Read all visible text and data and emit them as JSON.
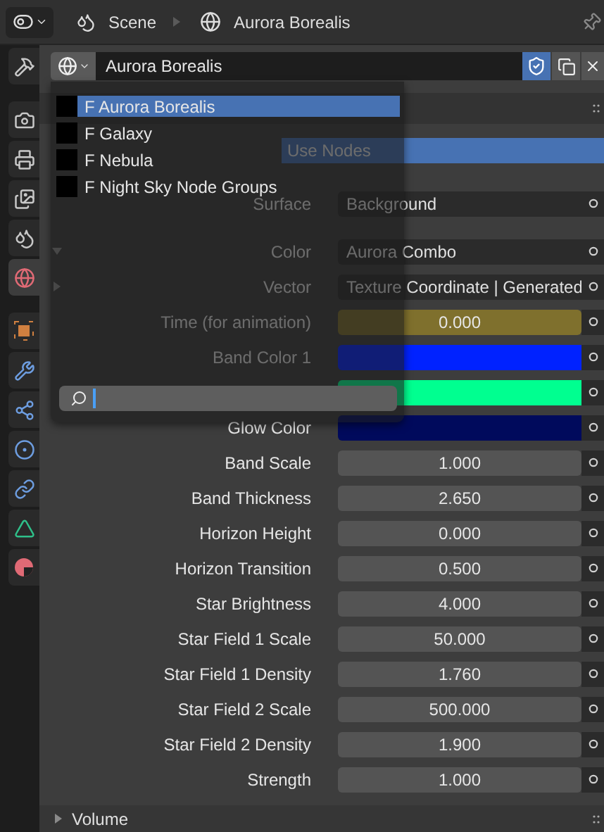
{
  "header": {
    "scene": "Scene",
    "world": "Aurora Borealis"
  },
  "sidebar": {
    "groups": [
      {
        "tabs": [
          {
            "kind": "tool",
            "selected": false
          }
        ]
      },
      {
        "tabs": [
          {
            "kind": "render",
            "selected": false
          },
          {
            "kind": "output",
            "selected": false
          },
          {
            "kind": "view_layer",
            "selected": false
          },
          {
            "kind": "scene",
            "selected": false
          },
          {
            "kind": "world",
            "selected": true
          }
        ]
      },
      {
        "tabs": [
          {
            "kind": "object",
            "selected": false
          },
          {
            "kind": "modifier",
            "selected": false
          },
          {
            "kind": "particles",
            "selected": false
          },
          {
            "kind": "physics",
            "selected": false
          },
          {
            "kind": "constraints",
            "selected": false
          },
          {
            "kind": "data",
            "selected": false
          },
          {
            "kind": "material",
            "selected": false
          }
        ]
      }
    ]
  },
  "datablock": {
    "name": "Aurora Borealis",
    "fake_user": true
  },
  "dropdown": {
    "items": [
      {
        "label": "F Aurora Borealis",
        "selected": true
      },
      {
        "label": "F Galaxy",
        "selected": false
      },
      {
        "label": "F Nebula",
        "selected": false
      },
      {
        "label": "F Night Sky Node Groups",
        "selected": false
      }
    ]
  },
  "use_nodes": {
    "label": "Use Nodes",
    "on": true
  },
  "inputs": [
    {
      "kind": "link",
      "label": "Surface",
      "value": "Background"
    },
    {
      "kind": "link",
      "label": "Color",
      "value": "Aurora Combo",
      "expanded": true
    },
    {
      "kind": "link",
      "label": "Vector",
      "value": "Texture Coordinate | Generated",
      "expanded": false
    },
    {
      "kind": "number",
      "label": "Time (for animation)",
      "value": "0.000",
      "keyed": true
    },
    {
      "kind": "color",
      "label": "Band Color 1",
      "color": "#0022ff"
    },
    {
      "kind": "color",
      "color": "#00ff90"
    },
    {
      "kind": "color",
      "label": "Glow Color",
      "color": "#000a5c"
    },
    {
      "kind": "number",
      "label": "Band Scale",
      "value": "1.000",
      "keyed": false
    },
    {
      "kind": "number",
      "label": "Band Thickness",
      "value": "2.650",
      "keyed": false
    },
    {
      "kind": "number",
      "label": "Horizon Height",
      "value": "0.000",
      "keyed": false
    },
    {
      "kind": "number",
      "label": "Horizon Transition",
      "value": "0.500",
      "keyed": false
    },
    {
      "kind": "number",
      "label": "Star Brightness",
      "value": "4.000",
      "keyed": false
    },
    {
      "kind": "number",
      "label": "Star Field 1 Scale",
      "value": "50.000",
      "keyed": false
    },
    {
      "kind": "number",
      "label": "Star Field 1 Density",
      "value": "1.760",
      "keyed": false
    },
    {
      "kind": "number",
      "label": "Star Field 2 Scale",
      "value": "500.000",
      "keyed": false
    },
    {
      "kind": "number",
      "label": "Star Field 2 Density",
      "value": "1.900",
      "keyed": false
    },
    {
      "kind": "number",
      "label": "Strength",
      "value": "1.000",
      "keyed": false
    }
  ],
  "volume_panel": {
    "title": "Volume",
    "expanded": false
  }
}
